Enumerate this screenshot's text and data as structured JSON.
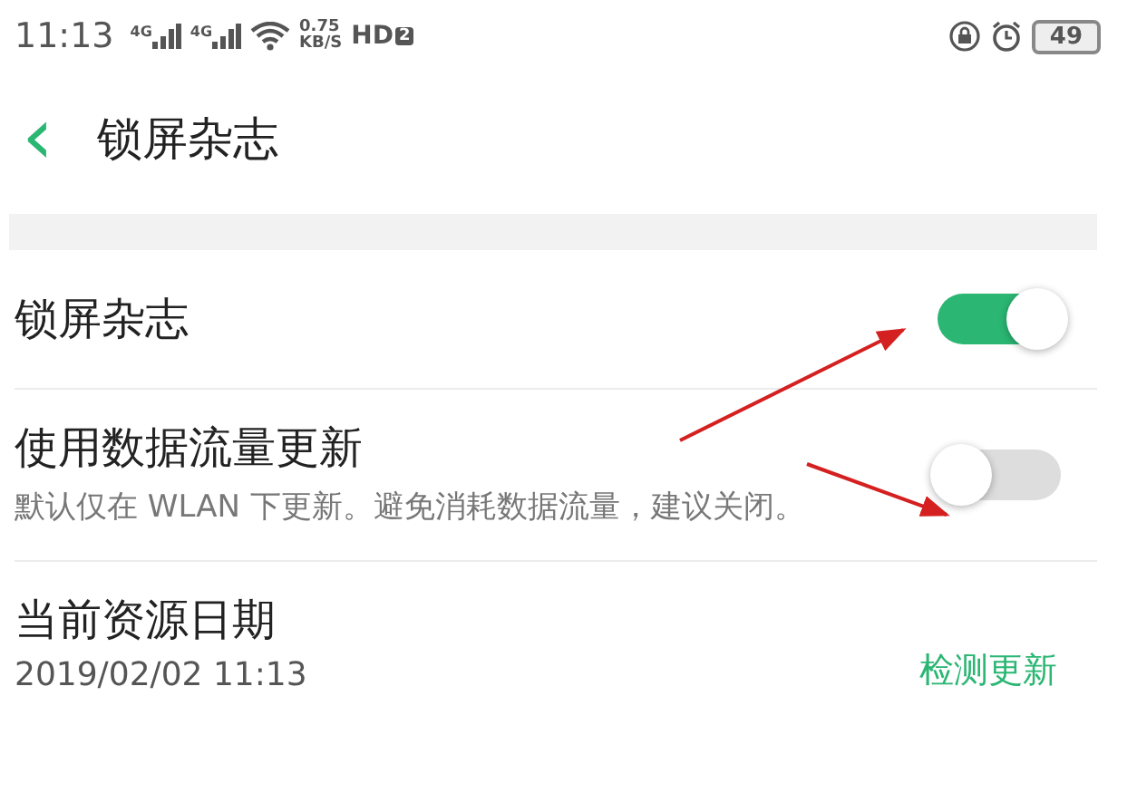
{
  "status_bar": {
    "time": "11:13",
    "signals": [
      {
        "network": "4G"
      },
      {
        "network": "4G"
      }
    ],
    "speed_value": "0.75",
    "speed_unit": "KB/S",
    "hd": "HD",
    "hd_slot": "2",
    "battery": "49"
  },
  "header": {
    "back": "‹",
    "title": "锁屏杂志"
  },
  "settings": [
    {
      "kind": "toggle",
      "title": "锁屏杂志",
      "on": true
    },
    {
      "kind": "toggle",
      "title": "使用数据流量更新",
      "description": "默认仅在 WLAN 下更新。避免消耗数据流量，建议关闭。",
      "on": false
    },
    {
      "kind": "info",
      "title": "当前资源日期",
      "subtitle": "2019/02/02 11:13",
      "action": "检测更新"
    }
  ]
}
